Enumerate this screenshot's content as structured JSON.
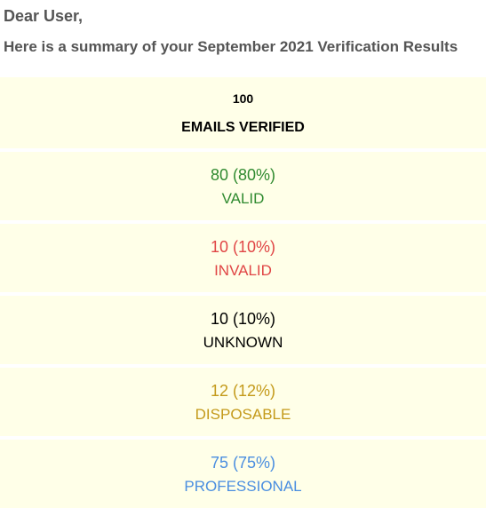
{
  "greeting": "Dear User,",
  "summary_line": "Here is a summary of your September 2021 Verification Results",
  "total": {
    "value": "100",
    "label": "EMAILS VERIFIED"
  },
  "stats": {
    "valid": {
      "value": "80 (80%)",
      "label": "VALID"
    },
    "invalid": {
      "value": "10 (10%)",
      "label": "INVALID"
    },
    "unknown": {
      "value": "10 (10%)",
      "label": "UNKNOWN"
    },
    "disposable": {
      "value": "12 (12%)",
      "label": "DISPOSABLE"
    },
    "professional": {
      "value": "75 (75%)",
      "label": "PROFESSIONAL"
    }
  }
}
